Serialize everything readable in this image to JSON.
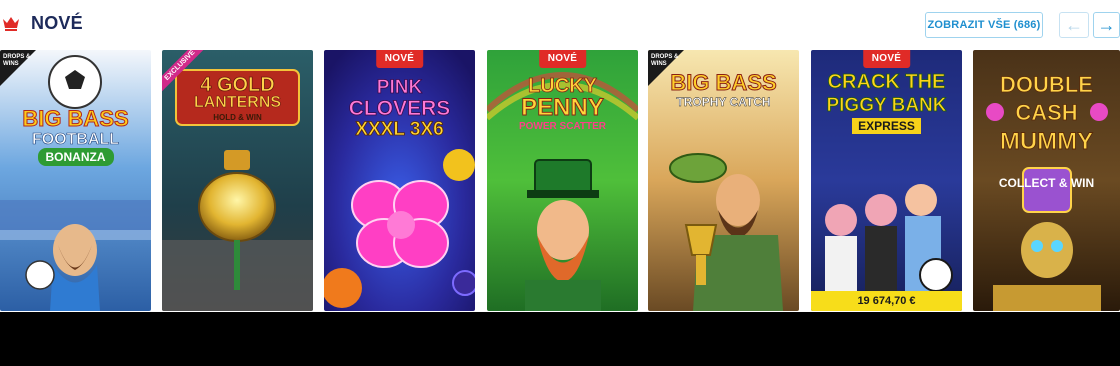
{
  "section": {
    "title": "NOVÉ",
    "icon": "crown-icon",
    "show_all_label": "ZOBRAZIT VŠE (686)",
    "prev_icon": "arrow-left-icon",
    "next_icon": "arrow-right-icon",
    "accent_color": "#1f8fcf"
  },
  "games": [
    {
      "title_line1": "BIG BASS",
      "title_line2": "FOOTBALL",
      "title_line3": "BONANZA",
      "badge": "DROPS & WINS",
      "tag": ""
    },
    {
      "title_line1": "4 GOLD",
      "title_line2": "LANTERNS",
      "title_line3": "HOLD & WIN",
      "badge": "EXCLUSIVE",
      "tag": ""
    },
    {
      "title_line1": "PINK",
      "title_line2": "CLOVERS",
      "title_line3": "XXXL 3X6",
      "badge": "",
      "tag": "NOVÉ"
    },
    {
      "title_line1": "LUCKY",
      "title_line2": "PENNY",
      "title_line3": "POWER SCATTER",
      "badge": "",
      "tag": "NOVÉ"
    },
    {
      "title_line1": "BIG BASS",
      "title_line2": "TROPHY CATCH",
      "title_line3": "",
      "badge": "DROPS & WINS",
      "tag": ""
    },
    {
      "title_line1": "CRACK THE",
      "title_line2": "PIGGY BANK",
      "title_line3": "EXPRESS",
      "badge": "",
      "tag": "NOVÉ",
      "jackpot": "19 674,70 €"
    },
    {
      "title_line1": "DOUBLE",
      "title_line2": "CASH",
      "title_line3": "MUMMY",
      "subtitle": "COLLECT & WIN",
      "badge": "",
      "tag": ""
    }
  ]
}
